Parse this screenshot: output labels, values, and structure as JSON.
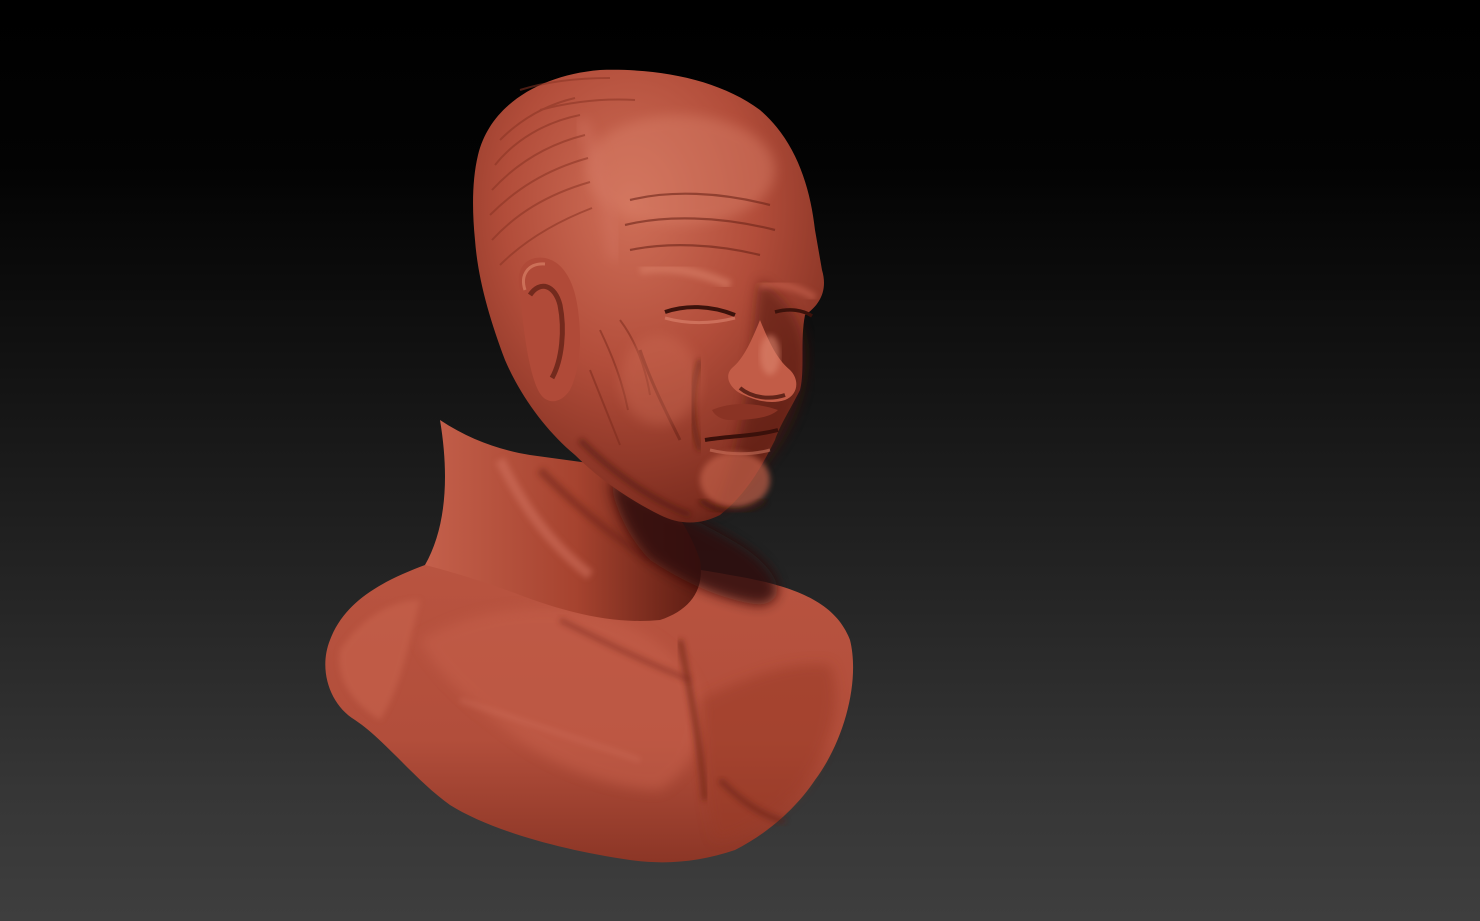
{
  "canvas": {
    "background_top": "#000000",
    "background_bottom": "#3e3e3e"
  },
  "model": {
    "icon": "sculpted-bust-icon",
    "material_color": "#b04a38",
    "shadow_color": "#3a120c",
    "highlight_color": "#d06a55"
  }
}
